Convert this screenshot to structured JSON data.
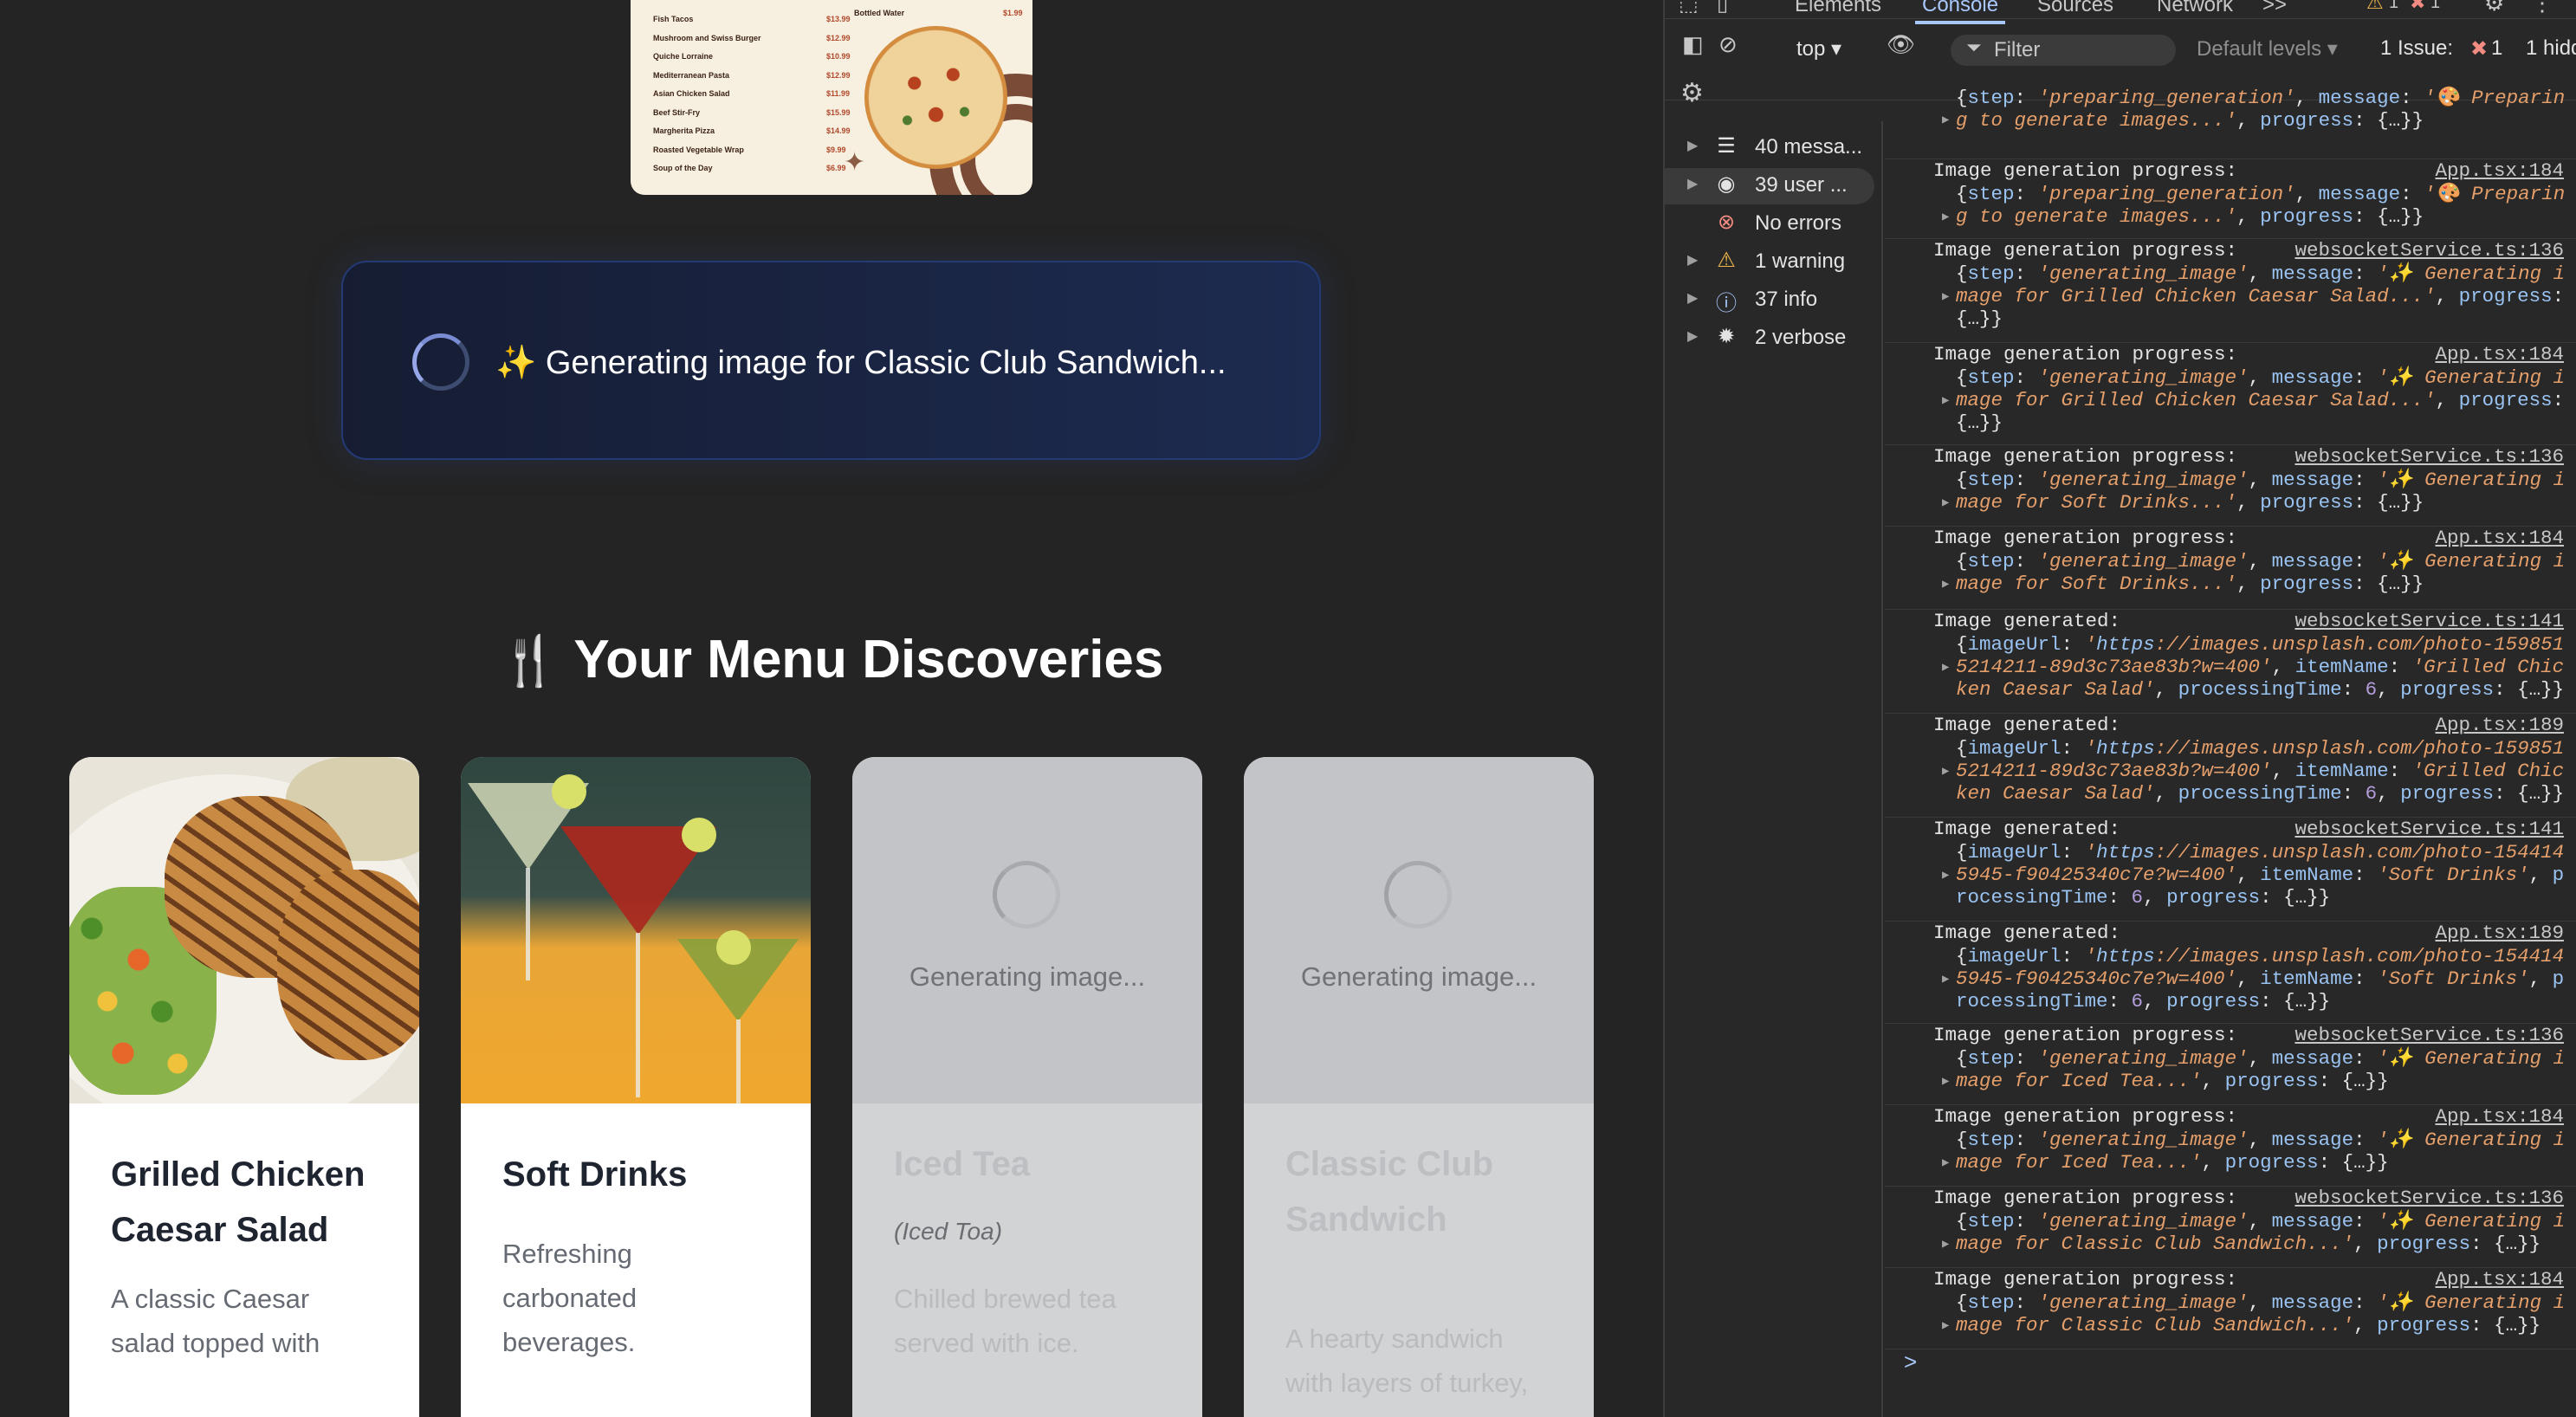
{
  "menu_preview": {
    "rows": [
      {
        "name": "Fish Tacos",
        "price": "$13.99"
      },
      {
        "name": "Mushroom and Swiss Burger",
        "price": "$12.99"
      },
      {
        "name": "Quiche Lorraine",
        "price": "$10.99"
      },
      {
        "name": "Mediterranean Pasta",
        "price": "$12.99"
      },
      {
        "name": "Asian Chicken Salad",
        "price": "$11.99"
      },
      {
        "name": "Beef Stir-Fry",
        "price": "$15.99"
      },
      {
        "name": "Margherita Pizza",
        "price": "$14.99"
      },
      {
        "name": "Roasted Vegetable Wrap",
        "price": "$9.99"
      },
      {
        "name": "Soup of the Day",
        "price": "$6.99"
      }
    ],
    "right_row": {
      "name": "Bottled Water",
      "price": "$1.99"
    }
  },
  "status": {
    "text": "✨ Generating image for Classic Club Sandwich..."
  },
  "section": {
    "icon": "fork-knife-icon",
    "emoji": "🍴",
    "title": "Your Menu Discoveries"
  },
  "cards": [
    {
      "title": "Grilled Chicken Caesar Salad",
      "subtitle": "",
      "description": "A classic Caesar salad topped with",
      "state": "done",
      "image": "grilled-chicken-image"
    },
    {
      "title": "Soft Drinks",
      "subtitle": "",
      "description": "Refreshing carbonated beverages.",
      "state": "done",
      "image": "cocktail-drinks-image"
    },
    {
      "title": "Iced Tea",
      "subtitle": "(Iced Toa)",
      "description": "Chilled brewed tea served with ice.",
      "state": "loading",
      "loading_text": "Generating image..."
    },
    {
      "title": "Classic Club Sandwich",
      "subtitle": "",
      "description": "A hearty sandwich with layers of turkey,",
      "state": "loading",
      "loading_text": "Generating image..."
    }
  ],
  "devtools": {
    "tabs": [
      "Elements",
      "Console",
      "Sources",
      "Network"
    ],
    "active_tab": "Console",
    "more": ">>",
    "badges": {
      "warnings": "1",
      "errors": "1"
    },
    "context": "top ▾",
    "filter_placeholder": "Filter",
    "levels": "Default levels ▾",
    "issues": "1 Issue:",
    "issues_count": "1",
    "hidden": "1 hidd",
    "sidebar": [
      {
        "label": "40 messa...",
        "icon": "list-icon"
      },
      {
        "label": "39 user ...",
        "icon": "user-icon",
        "selected": true
      },
      {
        "label": "No errors",
        "icon": "error-icon"
      },
      {
        "label": "1 warning",
        "icon": "warning-icon"
      },
      {
        "label": "37 info",
        "icon": "info-icon"
      },
      {
        "label": "2 verbose",
        "icon": "bug-icon"
      }
    ],
    "console_entries": [
      {
        "msg": "",
        "src": "",
        "obj": "{step: 'preparing_generation', message: '🎨 Preparing to generate images...', progress: {…}}"
      },
      {
        "msg": "Image generation progress:",
        "src": "App.tsx:184",
        "obj": "{step: 'preparing_generation', message: '🎨 Preparing to generate images...', progress: {…}}"
      },
      {
        "msg": "Image generation progress:",
        "src": "websocketService.ts:136",
        "obj": "{step: 'generating_image', message: '✨ Generating image for Grilled Chicken Caesar Salad...', progress: {…}}"
      },
      {
        "msg": "Image generation progress:",
        "src": "App.tsx:184",
        "obj": "{step: 'generating_image', message: '✨ Generating image for Grilled Chicken Caesar Salad...', progress: {…}}"
      },
      {
        "msg": "Image generation progress:",
        "src": "websocketService.ts:136",
        "obj": "{step: 'generating_image', message: '✨ Generating image for Soft Drinks...', progress: {…}}"
      },
      {
        "msg": "Image generation progress:",
        "src": "App.tsx:184",
        "obj": "{step: 'generating_image', message: '✨ Generating image for Soft Drinks...', progress: {…}}"
      },
      {
        "msg": "Image generated:",
        "src": "websocketService.ts:141",
        "obj": "{imageUrl: 'https://images.unsplash.com/photo-1598515214211-89d3c73ae83b?w=400', itemName: 'Grilled Chicken Caesar Salad', processingTime: 6, progress: {…}}"
      },
      {
        "msg": "Image generated:",
        "src": "App.tsx:189",
        "obj": "{imageUrl: 'https://images.unsplash.com/photo-1598515214211-89d3c73ae83b?w=400', itemName: 'Grilled Chicken Caesar Salad', processingTime: 6, progress: {…}}"
      },
      {
        "msg": "Image generated:",
        "src": "websocketService.ts:141",
        "obj": "{imageUrl: 'https://images.unsplash.com/photo-1544145945-f90425340c7e?w=400', itemName: 'Soft Drinks', processingTime: 6, progress: {…}}"
      },
      {
        "msg": "Image generated:",
        "src": "App.tsx:189",
        "obj": "{imageUrl: 'https://images.unsplash.com/photo-1544145945-f90425340c7e?w=400', itemName: 'Soft Drinks', processingTime: 6, progress: {…}}"
      },
      {
        "msg": "Image generation progress:",
        "src": "websocketService.ts:136",
        "obj": "{step: 'generating_image', message: '✨ Generating image for Iced Tea...', progress: {…}}"
      },
      {
        "msg": "Image generation progress:",
        "src": "App.tsx:184",
        "obj": "{step: 'generating_image', message: '✨ Generating image for Iced Tea...', progress: {…}}"
      },
      {
        "msg": "Image generation progress:",
        "src": "websocketService.ts:136",
        "obj": "{step: 'generating_image', message: '✨ Generating image for Classic Club Sandwich...', progress: {…}}"
      },
      {
        "msg": "Image generation progress:",
        "src": "App.tsx:184",
        "obj": "{step: 'generating_image', message: '✨ Generating image for Classic Club Sandwich...', progress: {…}}"
      }
    ],
    "prompt": ">"
  }
}
